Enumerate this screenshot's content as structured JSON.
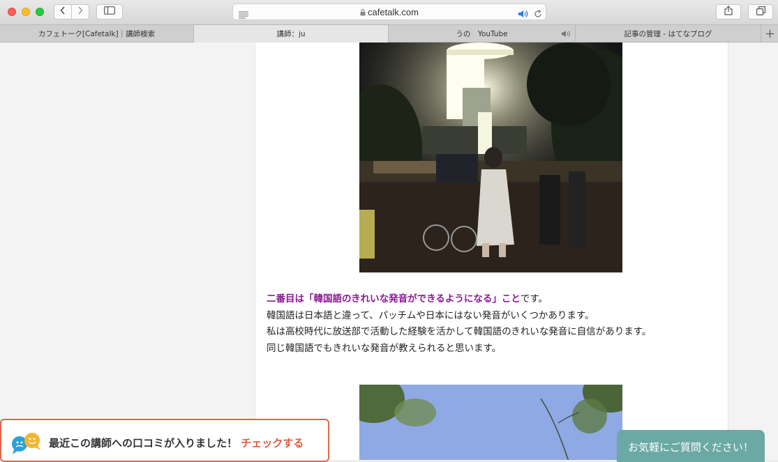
{
  "browser": {
    "url": "cafetalk.com",
    "tabs": [
      {
        "label": "カフェトーク[Cafetalk]｜講師検索",
        "active": false
      },
      {
        "label": "講師：ju",
        "active": true
      },
      {
        "label": "うの　YouTube",
        "active": false
      },
      {
        "label": "記事の管理 - はてなブログ",
        "active": false
      }
    ]
  },
  "article": {
    "highlight": "二番目は「韓国語のきれいな発音ができるようになる」こと",
    "highlight_tail": "です。",
    "lines": [
      "韓国語は日本語と違って、パッチムや日本にはない発音がいくつかあります。",
      "私は高校時代に放送部で活動した経験を活かして韓国語のきれいな発音に自信があります。",
      "同じ韓国語でもきれいな発音が教えられると思います。"
    ]
  },
  "review_banner": {
    "message": "最近この講師への口コミが入りました！",
    "link": "チェックする"
  },
  "chat_button": {
    "label": "お気軽にご質問ください！"
  }
}
